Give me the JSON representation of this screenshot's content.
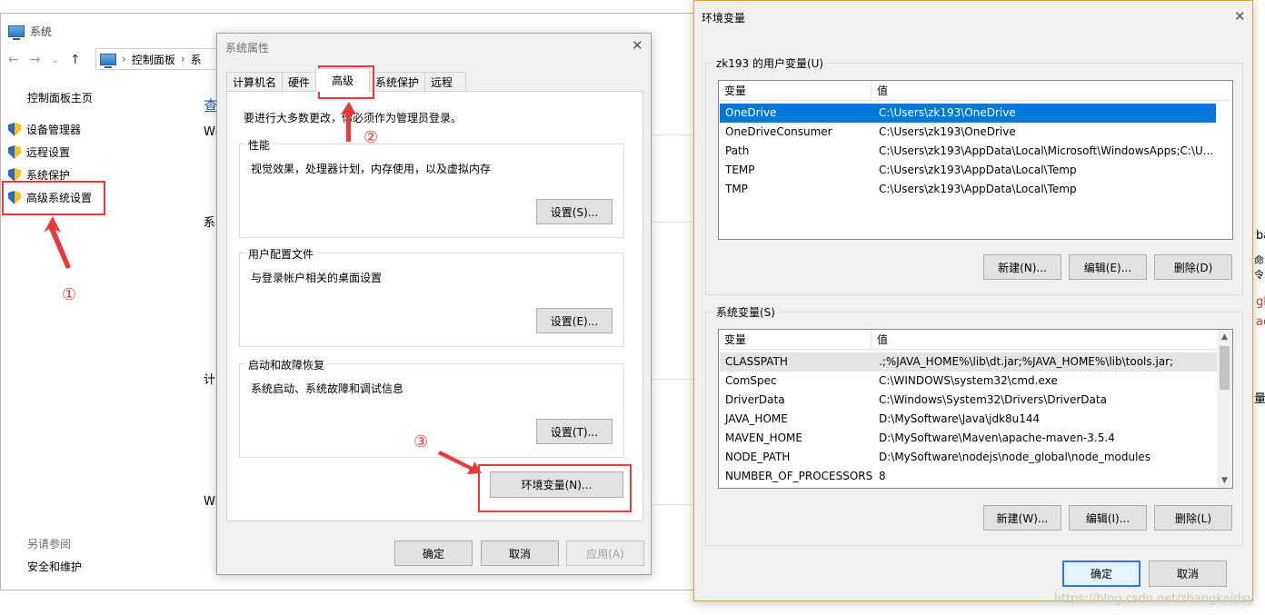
{
  "system_window": {
    "title": "系统",
    "nav": {
      "back": "←",
      "forward": "→",
      "down": "⌄",
      "up": "↑"
    },
    "breadcrumb": [
      "控制面板",
      "系"
    ],
    "left_pane": {
      "home": "控制面板主页",
      "links": [
        "设备管理器",
        "远程设置",
        "系统保护",
        "高级系统设置"
      ],
      "see_also_title": "另请参阅",
      "see_also_link": "安全和维护"
    },
    "main_fragments": [
      "查",
      "Wi",
      "系",
      "计",
      "Wi"
    ]
  },
  "system_properties": {
    "title": "系统属性",
    "tabs": [
      "计算机名",
      "硬件",
      "高级",
      "系统保护",
      "远程"
    ],
    "active_tab": "高级",
    "admin_note": "要进行大多数更改，你必须作为管理员登录。",
    "groups": [
      {
        "title": "性能",
        "desc": "视觉效果，处理器计划，内存使用，以及虚拟内存",
        "button": "设置(S)..."
      },
      {
        "title": "用户配置文件",
        "desc": "与登录帐户相关的桌面设置",
        "button": "设置(E)..."
      },
      {
        "title": "启动和故障恢复",
        "desc": "系统启动、系统故障和调试信息",
        "button": "设置(T)..."
      }
    ],
    "env_button": "环境变量(N)...",
    "ok": "确定",
    "cancel": "取消",
    "apply": "应用(A)"
  },
  "env_vars": {
    "title": "环境变量",
    "user_group_title": "zk193 的用户变量(U)",
    "col_var": "变量",
    "col_val": "值",
    "user_vars": [
      {
        "name": "OneDrive",
        "value": "C:\\Users\\zk193\\OneDrive"
      },
      {
        "name": "OneDriveConsumer",
        "value": "C:\\Users\\zk193\\OneDrive"
      },
      {
        "name": "Path",
        "value": "C:\\Users\\zk193\\AppData\\Local\\Microsoft\\WindowsApps;C:\\U..."
      },
      {
        "name": "TEMP",
        "value": "C:\\Users\\zk193\\AppData\\Local\\Temp"
      },
      {
        "name": "TMP",
        "value": "C:\\Users\\zk193\\AppData\\Local\\Temp"
      }
    ],
    "user_buttons": {
      "new": "新建(N)...",
      "edit": "编辑(E)...",
      "delete": "删除(D)"
    },
    "system_group_title": "系统变量(S)",
    "system_vars": [
      {
        "name": "CLASSPATH",
        "value": ".;%JAVA_HOME%\\lib\\dt.jar;%JAVA_HOME%\\lib\\tools.jar;"
      },
      {
        "name": "ComSpec",
        "value": "C:\\WINDOWS\\system32\\cmd.exe"
      },
      {
        "name": "DriverData",
        "value": "C:\\Windows\\System32\\Drivers\\DriverData"
      },
      {
        "name": "JAVA_HOME",
        "value": "D:\\MySoftware\\Java\\jdk8u144"
      },
      {
        "name": "MAVEN_HOME",
        "value": "D:\\MySoftware\\Maven\\apache-maven-3.5.4"
      },
      {
        "name": "NODE_PATH",
        "value": "D:\\MySoftware\\nodejs\\node_global\\node_modules"
      },
      {
        "name": "NUMBER_OF_PROCESSORS",
        "value": "8"
      }
    ],
    "system_buttons": {
      "new": "新建(W)...",
      "edit": "编辑(I)...",
      "delete": "删除(L)"
    },
    "ok": "确定",
    "cancel": "取消"
  },
  "annotations": {
    "step1": "①",
    "step2": "②",
    "step3": "③"
  },
  "edge_fragments": [
    "ba",
    "命令",
    "gl",
    "ac",
    "量"
  ],
  "watermark": "https://blog.csdn.net/zhangkaidsy",
  "colors": {
    "annotation_red": "#e8393b",
    "selection_blue": "#0078d7",
    "primary_border": "#2c7ad6"
  }
}
